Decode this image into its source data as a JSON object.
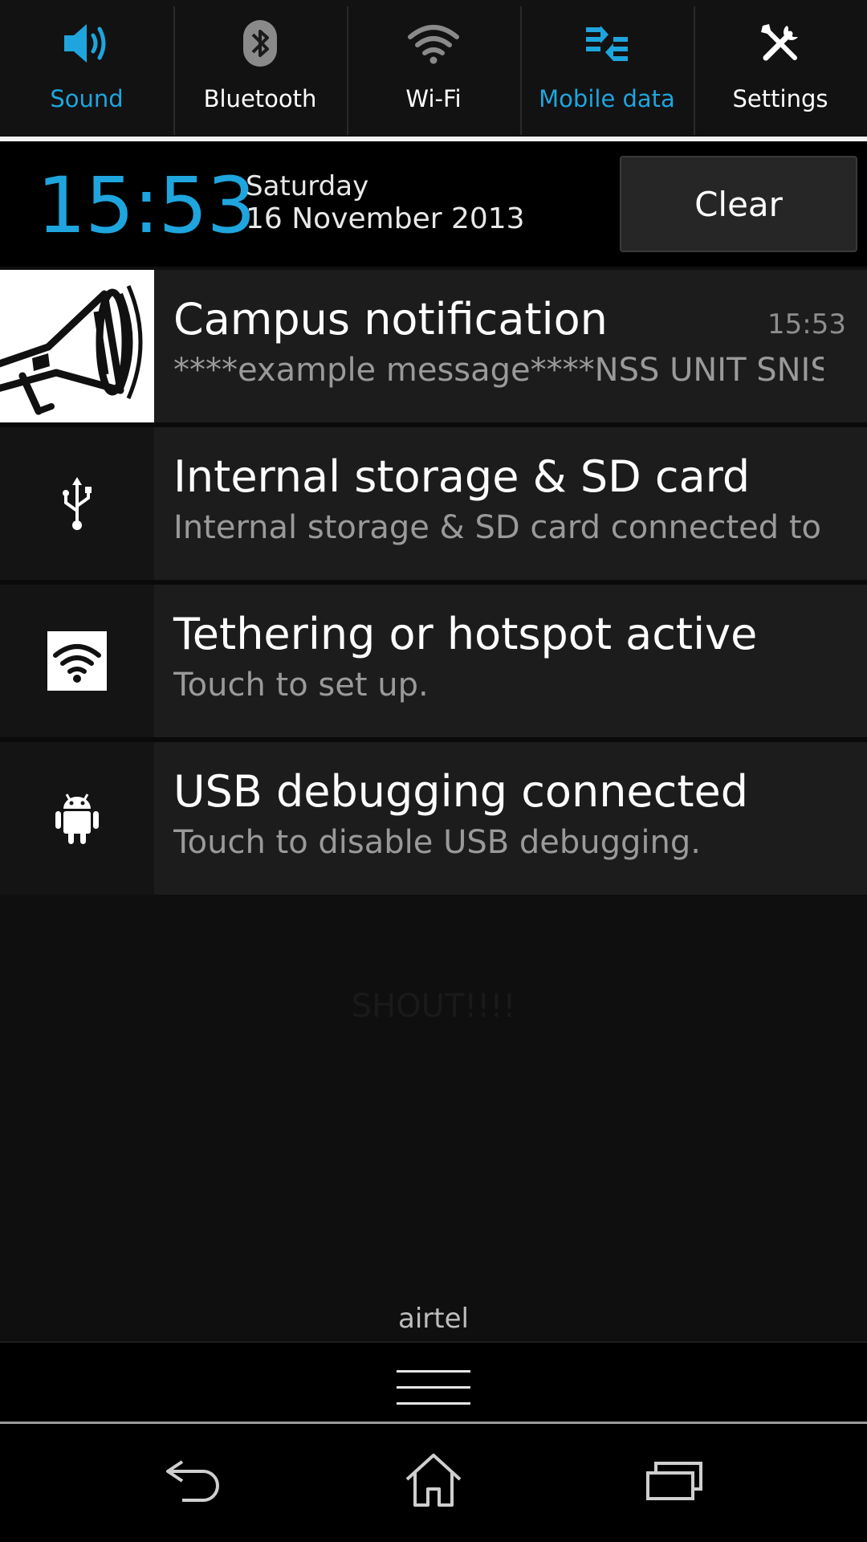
{
  "quick_settings": [
    {
      "label": "Sound",
      "icon": "sound-icon",
      "active": true
    },
    {
      "label": "Bluetooth",
      "icon": "bluetooth-icon",
      "active": false
    },
    {
      "label": "Wi-Fi",
      "icon": "wifi-icon",
      "active": false
    },
    {
      "label": "Mobile data",
      "icon": "mobile-data-icon",
      "active": true
    },
    {
      "label": "Settings",
      "icon": "settings-icon",
      "active": false
    }
  ],
  "header": {
    "time": "15:53",
    "day": "Saturday",
    "date": "16 November 2013",
    "clear_label": "Clear"
  },
  "notifications": [
    {
      "title": "Campus notification",
      "text": "****example message****NSS UNIT SNIST",
      "time": "15:53",
      "icon": "megaphone-icon"
    },
    {
      "title": "Internal storage & SD card",
      "text": "Internal storage & SD card connected to PC",
      "icon": "usb-icon"
    },
    {
      "title": "Tethering or hotspot active",
      "text": "Touch to set up.",
      "icon": "hotspot-icon"
    },
    {
      "title": "USB debugging connected",
      "text": "Touch to disable USB debugging.",
      "icon": "android-icon"
    }
  ],
  "watermark": "SHOUT!!!!",
  "carrier": "airtel",
  "colors": {
    "accent": "#1fa5dd",
    "background": "#0f0f0f"
  }
}
